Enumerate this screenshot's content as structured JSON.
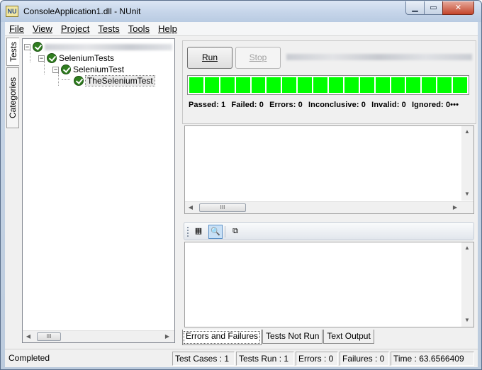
{
  "window": {
    "title": "ConsoleApplication1.dll - NUnit",
    "icon_text": "NU"
  },
  "window_buttons": {
    "minimize": "▁",
    "maximize": "▭",
    "close": "✕"
  },
  "menu": [
    "File",
    "View",
    "Project",
    "Tests",
    "Tools",
    "Help"
  ],
  "left_tabs": {
    "tests": "Tests",
    "categories": "Categories"
  },
  "tree": {
    "root": {
      "status_icon": "green-check-icon"
    },
    "nodes": [
      {
        "label": "SeleniumTests",
        "expander": "⊟"
      },
      {
        "label": "SeleniumTest",
        "expander": "⊟"
      },
      {
        "label": "TheSeleniumTest",
        "selected": true
      }
    ],
    "scroll_thumb": "III"
  },
  "run": {
    "run_label": "Run",
    "stop_label": "Stop",
    "progress_segments": 18,
    "progress_color": "#00ff00",
    "summary": {
      "passed": "Passed: 1",
      "failed": "Failed: 0",
      "errors": "Errors: 0",
      "inconclusive": "Inconclusive: 0",
      "invalid": "Invalid: 0",
      "ignored": "Ignored: 0•••"
    }
  },
  "errors_scroll_thumb": "III",
  "toolbar": {
    "icons": [
      "grid-icon",
      "zoom-icon",
      "copy-icon"
    ]
  },
  "bottom_tabs": [
    "Errors and Failures",
    "Tests Not Run",
    "Text Output"
  ],
  "status": {
    "state": "Completed",
    "test_cases": "Test Cases : 1",
    "tests_run": "Tests Run : 1",
    "errors": "Errors : 0",
    "failures": "Failures : 0",
    "time": "Time : 63.6566409"
  }
}
